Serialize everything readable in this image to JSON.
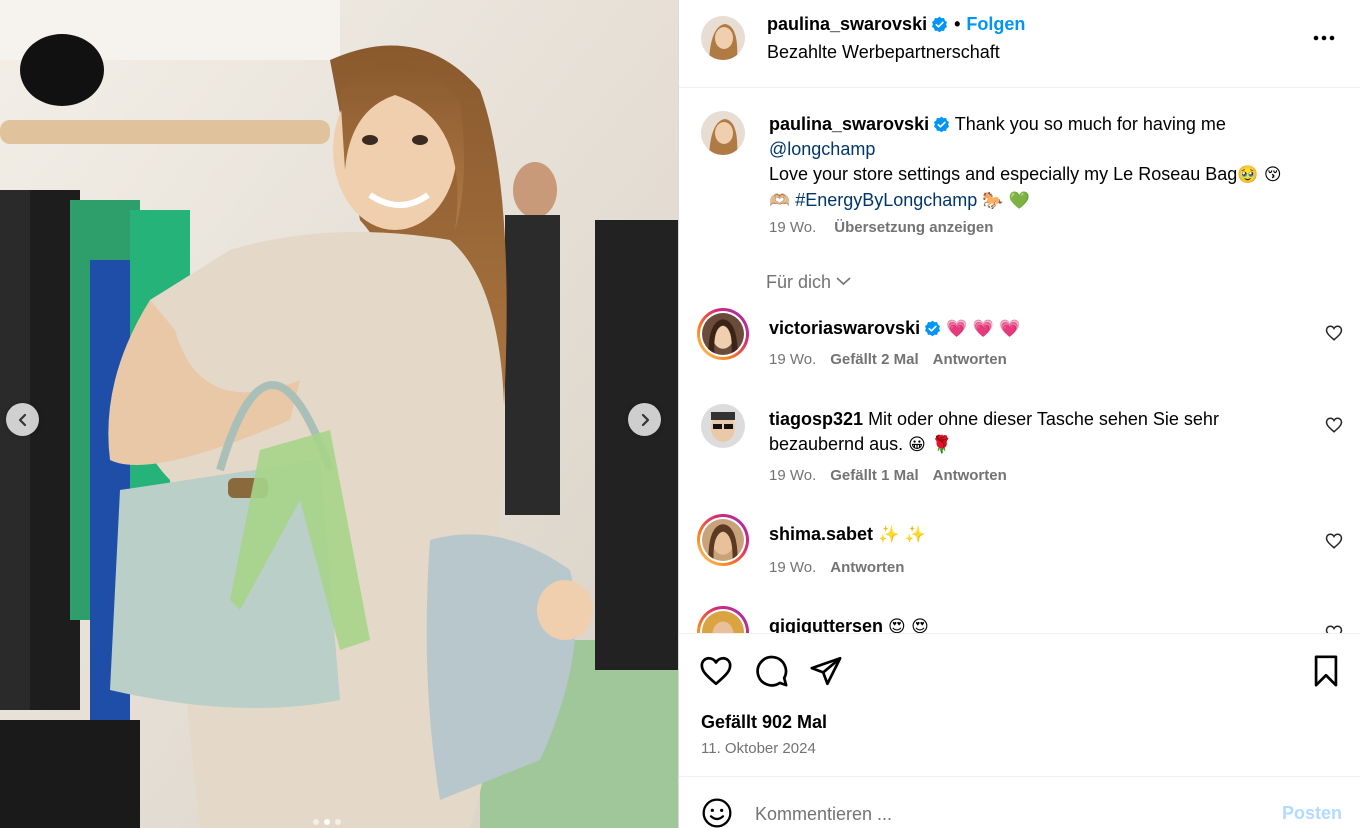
{
  "post": {
    "username": "paulina_swarovski",
    "follow_label": "Folgen",
    "header_dot": "•",
    "sponsored_label": "Bezahlte Werbepartnerschaft"
  },
  "caption": {
    "username": "paulina_swarovski",
    "text_part1": "Thank you so much for having me",
    "mention": "@longchamp",
    "text_part2": "Love your store settings and especially my Le Roseau Bag",
    "emoji1": "🥹 😚",
    "emoji2": "🫶🏼",
    "hashtag": "#EnergyByLongchamp",
    "emoji3": "🐎 💚",
    "age": "19 Wo.",
    "translate_label": "Übersetzung anzeigen"
  },
  "filter_label": "Für dich",
  "comments": [
    {
      "username": "victoriaswarovski",
      "text": "",
      "emoji": "💗 💗 💗",
      "age": "19 Wo.",
      "likes": "Gefällt 2 Mal",
      "reply_label": "Antworten",
      "verified": true
    },
    {
      "username": "tiagosp321",
      "text": "Mit oder ohne dieser Tasche sehen Sie sehr bezaubernd aus.",
      "emoji": "😀 🌹",
      "age": "19 Wo.",
      "likes": "Gefällt 1 Mal",
      "reply_label": "Antworten"
    },
    {
      "username": "shima.sabet",
      "text": "",
      "emoji": "✨ ✨",
      "age": "19 Wo.",
      "reply_label": "Antworten"
    },
    {
      "username": "gigiguttersen",
      "text": "",
      "emoji": "😍 😍"
    }
  ],
  "likes_count": "Gefällt 902 Mal",
  "post_date": "11. Oktober 2024",
  "comment_box": {
    "placeholder": "Kommentieren ...",
    "post_label": "Posten"
  },
  "carousel": {
    "slide_count": 3,
    "active_index": 1
  },
  "colors": {
    "link": "#0095f6",
    "muted": "#737373",
    "mention": "#00376b",
    "post_disabled": "#b3dbff"
  },
  "icons": [
    "chevron-left-icon",
    "chevron-right-icon",
    "verified-icon",
    "more-icon",
    "heart-icon",
    "comment-icon",
    "share-icon",
    "bookmark-icon",
    "emoji-icon",
    "chevron-down-icon"
  ]
}
